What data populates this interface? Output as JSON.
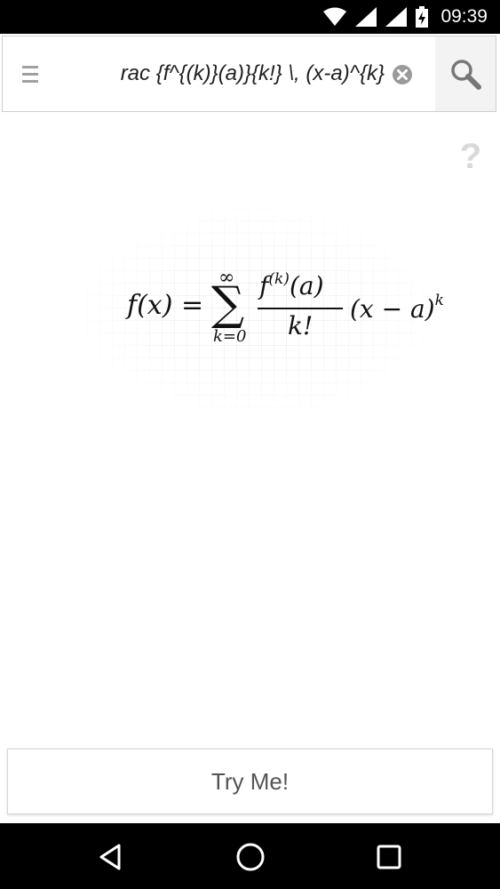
{
  "status_bar": {
    "time": "09:39",
    "icons": [
      "wifi-icon",
      "signal-icon",
      "battery-charging-icon"
    ]
  },
  "search_bar": {
    "query": "rac {f^{(k)}(a)}{k!} \\, (x-a)^{k}",
    "icons": [
      "menu-icon",
      "clear-icon",
      "search-icon"
    ]
  },
  "help": {
    "icon": "help-icon",
    "label": "?"
  },
  "formula": {
    "lhs": "f(x) =",
    "sum_symbol": "∑",
    "upper_limit": "∞",
    "lower_limit": "k=0",
    "numerator_base": "f",
    "numerator_exp": "(k)",
    "numerator_arg": "(a)",
    "denominator": "k!",
    "tail_base": "(x − a)",
    "tail_exp": "k"
  },
  "try_button": {
    "label": "Try Me!"
  },
  "nav_bar": {
    "icons": [
      "back-icon",
      "home-icon",
      "recents-icon"
    ]
  },
  "colors": {
    "status_bar": "#000000",
    "nav_bar": "#000000",
    "background": "#ffffff",
    "help_icon": "#d9d9d9"
  }
}
